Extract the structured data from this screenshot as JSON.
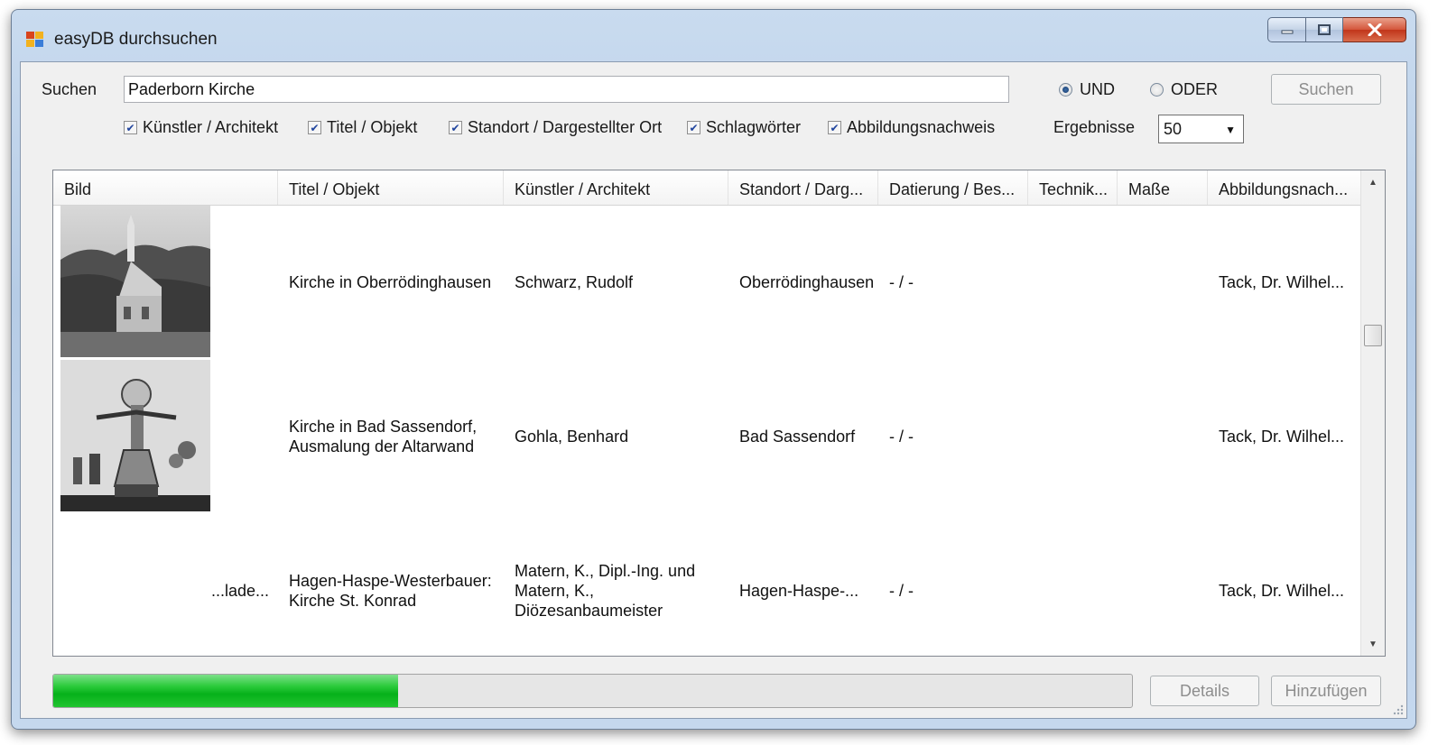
{
  "window": {
    "title": "easyDB durchsuchen"
  },
  "search": {
    "label": "Suchen",
    "value": "Paderborn Kirche",
    "button": "Suchen",
    "mode_options": [
      {
        "label": "UND",
        "selected": true
      },
      {
        "label": "ODER",
        "selected": false
      }
    ],
    "fields": [
      {
        "label": "Künstler / Architekt",
        "checked": true
      },
      {
        "label": "Titel / Objekt",
        "checked": true
      },
      {
        "label": "Standort / Dargestellter Ort",
        "checked": true
      },
      {
        "label": "Schlagwörter",
        "checked": true
      },
      {
        "label": "Abbildungsnachweis",
        "checked": true
      }
    ],
    "results_label": "Ergebnisse",
    "results_value": "50"
  },
  "grid": {
    "columns": [
      "Bild",
      "Titel / Objekt",
      "Künstler / Architekt",
      "Standort / Darg...",
      "Datierung / Bes...",
      "Technik...",
      "Maße",
      "Abbildungsnach..."
    ],
    "rows": [
      {
        "image": "church-photo",
        "bild": "",
        "titel": "Kirche in Oberrödinghausen",
        "kuenstler": "Schwarz, Rudolf",
        "standort": "Oberrödinghausen",
        "datierung": "- / -",
        "technik": "",
        "masse": "",
        "abbildung": "Tack, Dr. Wilhel..."
      },
      {
        "image": "altar-mural-photo",
        "bild": "",
        "titel": "Kirche in Bad Sassendorf, Ausmalung der Altarwand",
        "kuenstler": "Gohla, Benhard",
        "standort": "Bad Sassendorf",
        "datierung": "- / -",
        "technik": "",
        "masse": "",
        "abbildung": "Tack, Dr. Wilhel..."
      },
      {
        "image": "",
        "bild": "...lade...",
        "titel": "Hagen-Haspe-Westerbauer: Kirche St. Konrad",
        "kuenstler": "Matern, K., Dipl.-Ing. und Matern, K., Diözesanbaumeister",
        "standort": "Hagen-Haspe-...",
        "datierung": "- / -",
        "technik": "",
        "masse": "",
        "abbildung": "Tack, Dr. Wilhel..."
      }
    ]
  },
  "progress": {
    "fraction": 0.32
  },
  "buttons": {
    "details": "Details",
    "add": "Hinzufügen"
  }
}
